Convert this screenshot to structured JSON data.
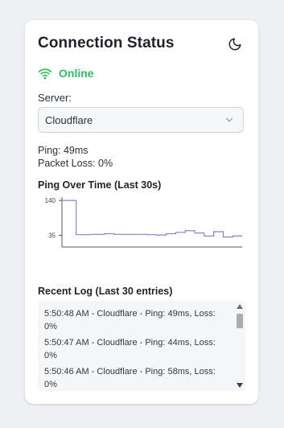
{
  "header": {
    "title": "Connection Status",
    "theme_icon": "moon-icon"
  },
  "status": {
    "icon": "wifi-icon",
    "text": "Online",
    "color": "#2fbf5b"
  },
  "server": {
    "label": "Server:",
    "selected": "Cloudflare",
    "dropdown_icon": "chevron-down-icon"
  },
  "stats": {
    "ping": "Ping: 49ms",
    "loss": "Packet Loss: 0%"
  },
  "chart": {
    "title": "Ping Over Time (Last 30s)"
  },
  "chart_data": {
    "type": "line",
    "title": "Ping Over Time (Last 30s)",
    "xlabel": "",
    "ylabel": "",
    "y_ticks": [
      "140",
      "35"
    ],
    "ylim": [
      0,
      150
    ],
    "grid": false,
    "series": [
      {
        "color": "#8b7fd6",
        "step": true,
        "values": [
          140,
          140,
          140,
          37,
          37,
          37,
          38,
          38,
          38,
          40,
          40,
          38,
          38,
          38,
          38,
          38,
          38,
          38,
          37,
          37,
          36,
          36,
          40,
          40,
          44,
          44,
          49,
          49,
          42,
          42,
          33,
          33,
          46,
          46,
          30,
          30,
          33,
          33,
          33
        ]
      }
    ]
  },
  "log": {
    "title": "Recent Log (Last 30 entries)",
    "entries": [
      {
        "line1": "5:50:48 AM - Cloudflare - Ping: 49ms, Loss:",
        "line2": "0%"
      },
      {
        "line1": "5:50:47 AM - Cloudflare - Ping: 44ms, Loss:",
        "line2": "0%"
      },
      {
        "line1": "5:50:46 AM - Cloudflare - Ping: 58ms, Loss:",
        "line2": "0%"
      }
    ]
  }
}
